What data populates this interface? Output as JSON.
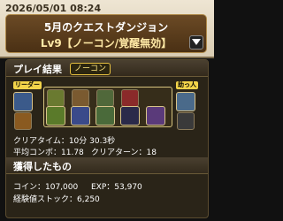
{
  "header": {
    "datetime": "2026/05/01 08:24",
    "title": "5月のクエストダンジョン",
    "subtitle": "Lv9【ノーコン/覚醒無効】"
  },
  "result": {
    "title": "プレイ結果",
    "badge": "ノーコン",
    "leader_tag": "リーダー",
    "helper_tag": "助っ人",
    "clear_time": "クリアタイム：10分 30.3秒",
    "avg_combo": "平均コンボ：11.78",
    "clear_turn": "クリアターン：18"
  },
  "rewards": {
    "title": "獲得したもの",
    "coin": "コイン：107,000",
    "exp": "EXP：53,970",
    "stock": "経験値ストック：6,250"
  },
  "colors": {
    "accent": "#e6c040",
    "panel": "#2a2418"
  }
}
